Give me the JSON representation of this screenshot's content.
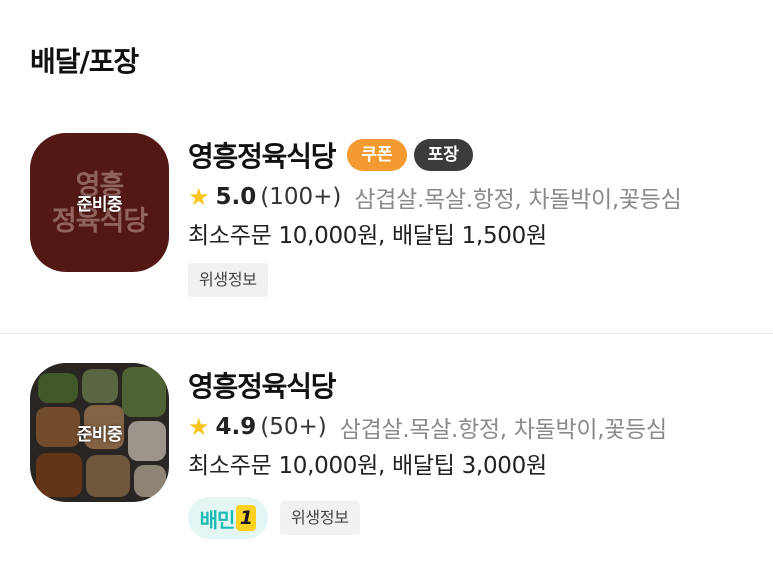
{
  "section": {
    "title": "배달/포장"
  },
  "stores": [
    {
      "thumbnail": {
        "logo_line1": "영흥",
        "logo_line2": "정육식당",
        "status": "준비중"
      },
      "name": "영흥정육식당",
      "badges": [
        "쿠폰",
        "포장"
      ],
      "rating": {
        "star": "★",
        "score": "5.0",
        "count": "(100+)"
      },
      "menu": "삼겹살.목살.항정, 차돌박이,꽃등심",
      "order_info": "최소주문 10,000원, 배달팁 1,500원",
      "tags": [
        "위생정보"
      ],
      "colors": {
        "badge_coupon": "#f39a31",
        "badge_pack": "#3b3b3b",
        "thumb_bg": "#74221c"
      }
    },
    {
      "thumbnail": {
        "status": "준비중"
      },
      "name": "영흥정육식당",
      "rating": {
        "star": "★",
        "score": "4.9",
        "count": "(50+)"
      },
      "menu": "삼겹살.목살.항정, 차돌박이,꽃등심",
      "order_info": "최소주문 10,000원, 배달팁 3,000원",
      "baemin1": {
        "text": "배민",
        "number": "1"
      },
      "tags": [
        "위생정보"
      ],
      "colors": {
        "baemin1_text": "#1bbdb3",
        "baemin1_bg": "#e3f6f4",
        "star": "#f8c51c"
      }
    }
  ]
}
